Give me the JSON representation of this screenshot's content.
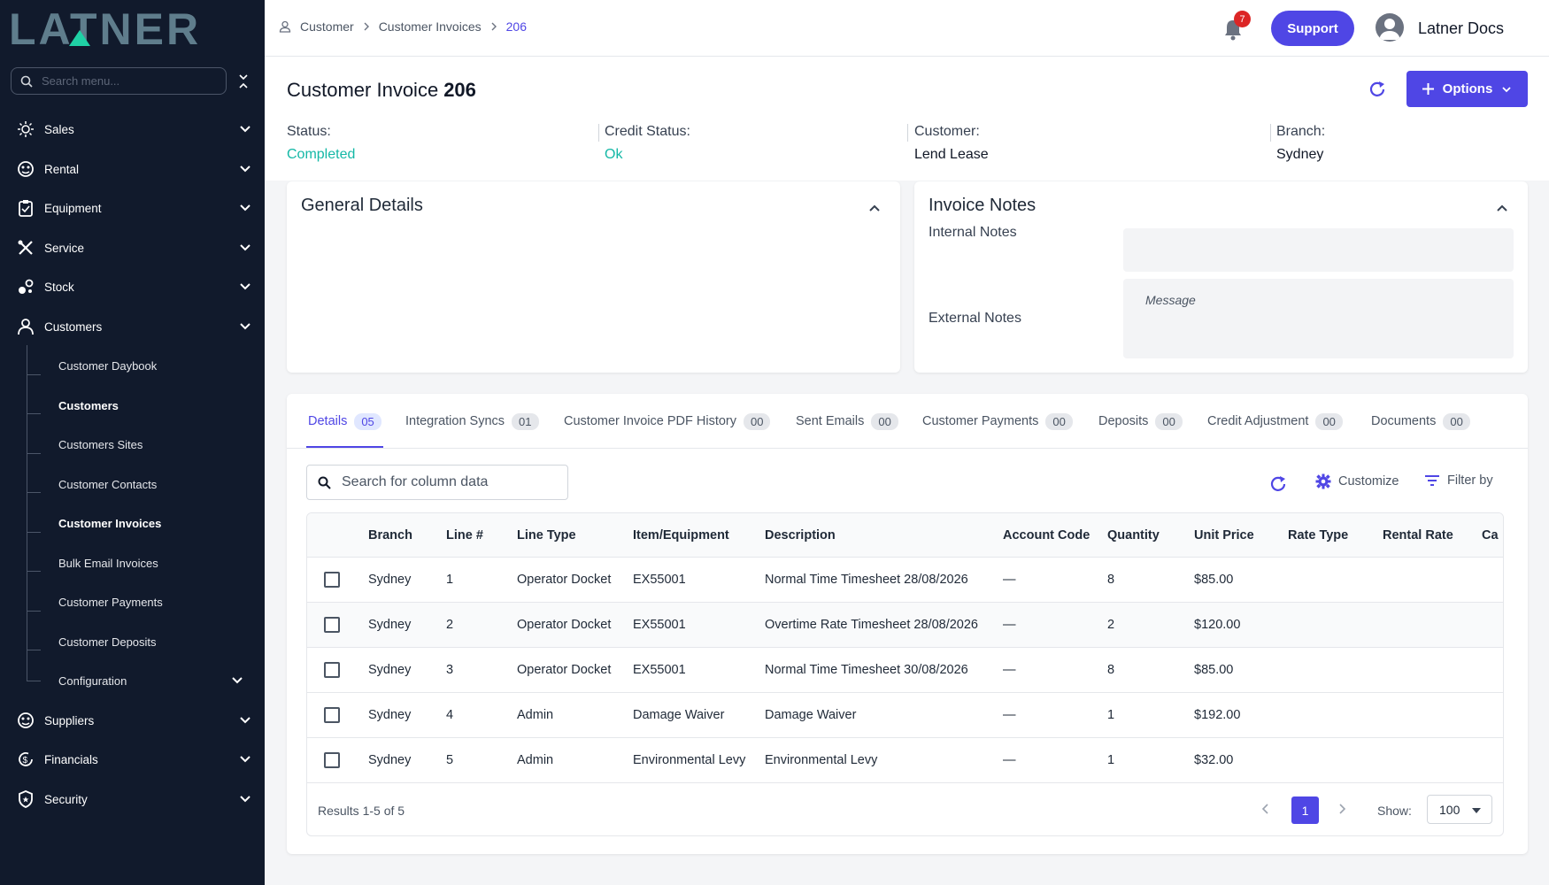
{
  "brand": {
    "logo_text": "LATNER",
    "logo_color": "#5f7d8c",
    "accent": "#4f46e5"
  },
  "sidebar": {
    "search_placeholder": "Search menu...",
    "items": [
      {
        "label": "Sales",
        "icon": "sun-gear-icon"
      },
      {
        "label": "Rental",
        "icon": "rental-icon"
      },
      {
        "label": "Equipment",
        "icon": "clipboard-icon"
      },
      {
        "label": "Service",
        "icon": "tools-icon"
      },
      {
        "label": "Stock",
        "icon": "stock-icon"
      },
      {
        "label": "Customers",
        "icon": "user-icon"
      },
      {
        "label": "Suppliers",
        "icon": "suppliers-icon"
      },
      {
        "label": "Financials",
        "icon": "dollar-cycle-icon"
      },
      {
        "label": "Security",
        "icon": "shield-icon"
      }
    ],
    "customers_sub": [
      {
        "label": "Customer Daybook"
      },
      {
        "label": "Customers"
      },
      {
        "label": "Customers Sites"
      },
      {
        "label": "Customer Contacts"
      },
      {
        "label": "Customer Invoices"
      },
      {
        "label": "Bulk Email Invoices"
      },
      {
        "label": "Customer Payments"
      },
      {
        "label": "Customer Deposits"
      },
      {
        "label": "Configuration"
      }
    ]
  },
  "topbar": {
    "breadcrumb": [
      "Customer",
      "Customer Invoices",
      "206"
    ],
    "notifications": "7",
    "support_label": "Support",
    "user_name": "Latner Docs"
  },
  "header": {
    "title": "Customer Invoice",
    "number": "206",
    "options_label": "Options",
    "status_label": "Status:",
    "status_value": "Completed",
    "credit_label": "Credit Status:",
    "credit_value": "Ok",
    "customer_label": "Customer:",
    "customer_value": "Lend Lease",
    "branch_label": "Branch:",
    "branch_value": "Sydney",
    "status_color": "#14b8a6"
  },
  "general": {
    "title": "General Details"
  },
  "notes": {
    "title": "Invoice Notes",
    "internal_label": "Internal Notes",
    "external_label": "External Notes",
    "external_placeholder": "Message"
  },
  "tabs": [
    {
      "label": "Details",
      "count": "05"
    },
    {
      "label": "Integration Syncs",
      "count": "01"
    },
    {
      "label": "Customer Invoice PDF History",
      "count": "00"
    },
    {
      "label": "Sent Emails",
      "count": "00"
    },
    {
      "label": "Customer Payments",
      "count": "00"
    },
    {
      "label": "Deposits",
      "count": "00"
    },
    {
      "label": "Credit Adjustment",
      "count": "00"
    },
    {
      "label": "Documents",
      "count": "00"
    }
  ],
  "toolbar": {
    "search_placeholder": "Search for column data",
    "customize_label": "Customize",
    "filter_label": "Filter by"
  },
  "table": {
    "columns": [
      "Branch",
      "Line #",
      "Line Type",
      "Item/Equipment",
      "Description",
      "Account Code",
      "Quantity",
      "Unit Price",
      "Rate Type",
      "Rental Rate",
      "Ca"
    ],
    "rows": [
      [
        "Sydney",
        "1",
        "Operator Docket",
        "EX55001",
        "Normal Time Timesheet 28/08/2026",
        "—",
        "8",
        "$85.00"
      ],
      [
        "Sydney",
        "2",
        "Operator Docket",
        "EX55001",
        "Overtime Rate Timesheet 28/08/2026",
        "—",
        "2",
        "$120.00"
      ],
      [
        "Sydney",
        "3",
        "Operator Docket",
        "EX55001",
        "Normal Time Timesheet 30/08/2026",
        "—",
        "8",
        "$85.00"
      ],
      [
        "Sydney",
        "4",
        "Admin",
        "Damage Waiver",
        "Damage Waiver",
        "—",
        "1",
        "$192.00"
      ],
      [
        "Sydney",
        "5",
        "Admin",
        "Environmental Levy",
        "Environmental Levy",
        "—",
        "1",
        "$32.00"
      ]
    ]
  },
  "footer": {
    "results": "Results 1-5 of 5",
    "page": "1",
    "show_label": "Show:",
    "show_value": "100"
  }
}
